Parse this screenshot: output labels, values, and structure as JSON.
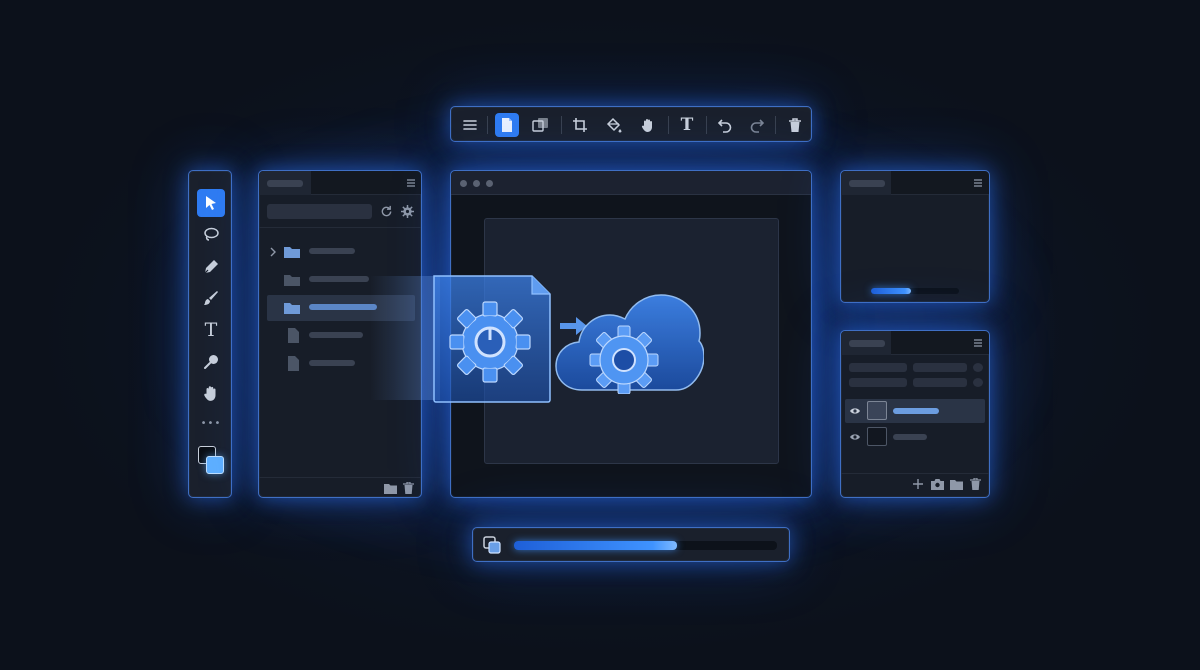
{
  "icons": {
    "menu": "menu-icon",
    "document": "document-icon",
    "layers_copy": "duplicate-icon",
    "crop": "crop-icon",
    "fill": "paint-bucket-icon",
    "hand": "hand-icon",
    "text": "text-icon",
    "undo": "undo-icon",
    "redo": "redo-icon",
    "trash": "trash-icon"
  },
  "top_toolbar": {
    "text_tool_glyph": "T"
  },
  "left_toolbar": {
    "text_tool_glyph": "T",
    "more_glyph": "•••"
  },
  "progress": {
    "fraction": 0.62
  },
  "preview": {
    "fraction": 0.45
  },
  "colors": {
    "accent": "#2f7cf2",
    "glow": "#2d78ff",
    "panel": "#171d28"
  }
}
